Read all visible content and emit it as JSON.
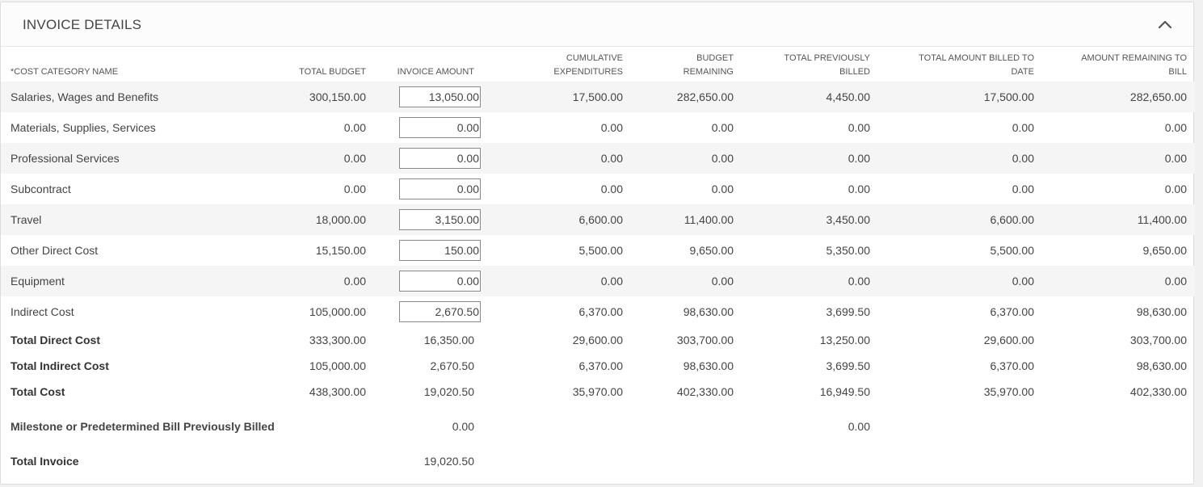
{
  "panel": {
    "title": "INVOICE DETAILS",
    "collapse_icon": "chevron-up-icon"
  },
  "columns": {
    "name": "COST CATEGORY NAME",
    "required_mark": "*",
    "total_budget": "TOTAL BUDGET",
    "invoice_amount": "INVOICE AMOUNT",
    "cumulative_1": "CUMULATIVE",
    "cumulative_2": "EXPENDITURES",
    "budget_remaining_1": "BUDGET",
    "budget_remaining_2": "REMAINING",
    "prev_billed_1": "TOTAL PREVIOUSLY",
    "prev_billed_2": "BILLED",
    "billed_to_date_1": "TOTAL AMOUNT BILLED TO",
    "billed_to_date_2": "DATE",
    "remaining_to_bill_1": "AMOUNT REMAINING TO",
    "remaining_to_bill_2": "BILL"
  },
  "rows": [
    {
      "name": "Salaries, Wages and Benefits",
      "total_budget": "300,150.00",
      "invoice_amount": "13,050.00",
      "cumulative": "17,500.00",
      "budget_remaining": "282,650.00",
      "prev_billed": "4,450.00",
      "billed_to_date": "17,500.00",
      "remaining_to_bill": "282,650.00"
    },
    {
      "name": "Materials, Supplies, Services",
      "total_budget": "0.00",
      "invoice_amount": "0.00",
      "cumulative": "0.00",
      "budget_remaining": "0.00",
      "prev_billed": "0.00",
      "billed_to_date": "0.00",
      "remaining_to_bill": "0.00"
    },
    {
      "name": "Professional Services",
      "total_budget": "0.00",
      "invoice_amount": "0.00",
      "cumulative": "0.00",
      "budget_remaining": "0.00",
      "prev_billed": "0.00",
      "billed_to_date": "0.00",
      "remaining_to_bill": "0.00"
    },
    {
      "name": "Subcontract",
      "total_budget": "0.00",
      "invoice_amount": "0.00",
      "cumulative": "0.00",
      "budget_remaining": "0.00",
      "prev_billed": "0.00",
      "billed_to_date": "0.00",
      "remaining_to_bill": "0.00"
    },
    {
      "name": "Travel",
      "total_budget": "18,000.00",
      "invoice_amount": "3,150.00",
      "cumulative": "6,600.00",
      "budget_remaining": "11,400.00",
      "prev_billed": "3,450.00",
      "billed_to_date": "6,600.00",
      "remaining_to_bill": "11,400.00"
    },
    {
      "name": "Other Direct Cost",
      "total_budget": "15,150.00",
      "invoice_amount": "150.00",
      "cumulative": "5,500.00",
      "budget_remaining": "9,650.00",
      "prev_billed": "5,350.00",
      "billed_to_date": "5,500.00",
      "remaining_to_bill": "9,650.00"
    },
    {
      "name": "Equipment",
      "total_budget": "0.00",
      "invoice_amount": "0.00",
      "cumulative": "0.00",
      "budget_remaining": "0.00",
      "prev_billed": "0.00",
      "billed_to_date": "0.00",
      "remaining_to_bill": "0.00"
    },
    {
      "name": "Indirect Cost",
      "total_budget": "105,000.00",
      "invoice_amount": "2,670.50",
      "cumulative": "6,370.00",
      "budget_remaining": "98,630.00",
      "prev_billed": "3,699.50",
      "billed_to_date": "6,370.00",
      "remaining_to_bill": "98,630.00"
    }
  ],
  "totals": [
    {
      "name": "Total Direct Cost",
      "total_budget": "333,300.00",
      "invoice_amount": "16,350.00",
      "cumulative": "29,600.00",
      "budget_remaining": "303,700.00",
      "prev_billed": "13,250.00",
      "billed_to_date": "29,600.00",
      "remaining_to_bill": "303,700.00"
    },
    {
      "name": "Total Indirect Cost",
      "total_budget": "105,000.00",
      "invoice_amount": "2,670.50",
      "cumulative": "6,370.00",
      "budget_remaining": "98,630.00",
      "prev_billed": "3,699.50",
      "billed_to_date": "6,370.00",
      "remaining_to_bill": "98,630.00"
    },
    {
      "name": "Total Cost",
      "total_budget": "438,300.00",
      "invoice_amount": "19,020.50",
      "cumulative": "35,970.00",
      "budget_remaining": "402,330.00",
      "prev_billed": "16,949.50",
      "billed_to_date": "35,970.00",
      "remaining_to_bill": "402,330.00"
    }
  ],
  "milestone": {
    "name": "Milestone or Predetermined Bill Previously Billed",
    "invoice_amount": "0.00",
    "prev_billed": "0.00"
  },
  "total_invoice": {
    "name": "Total Invoice",
    "invoice_amount": "19,020.50"
  }
}
